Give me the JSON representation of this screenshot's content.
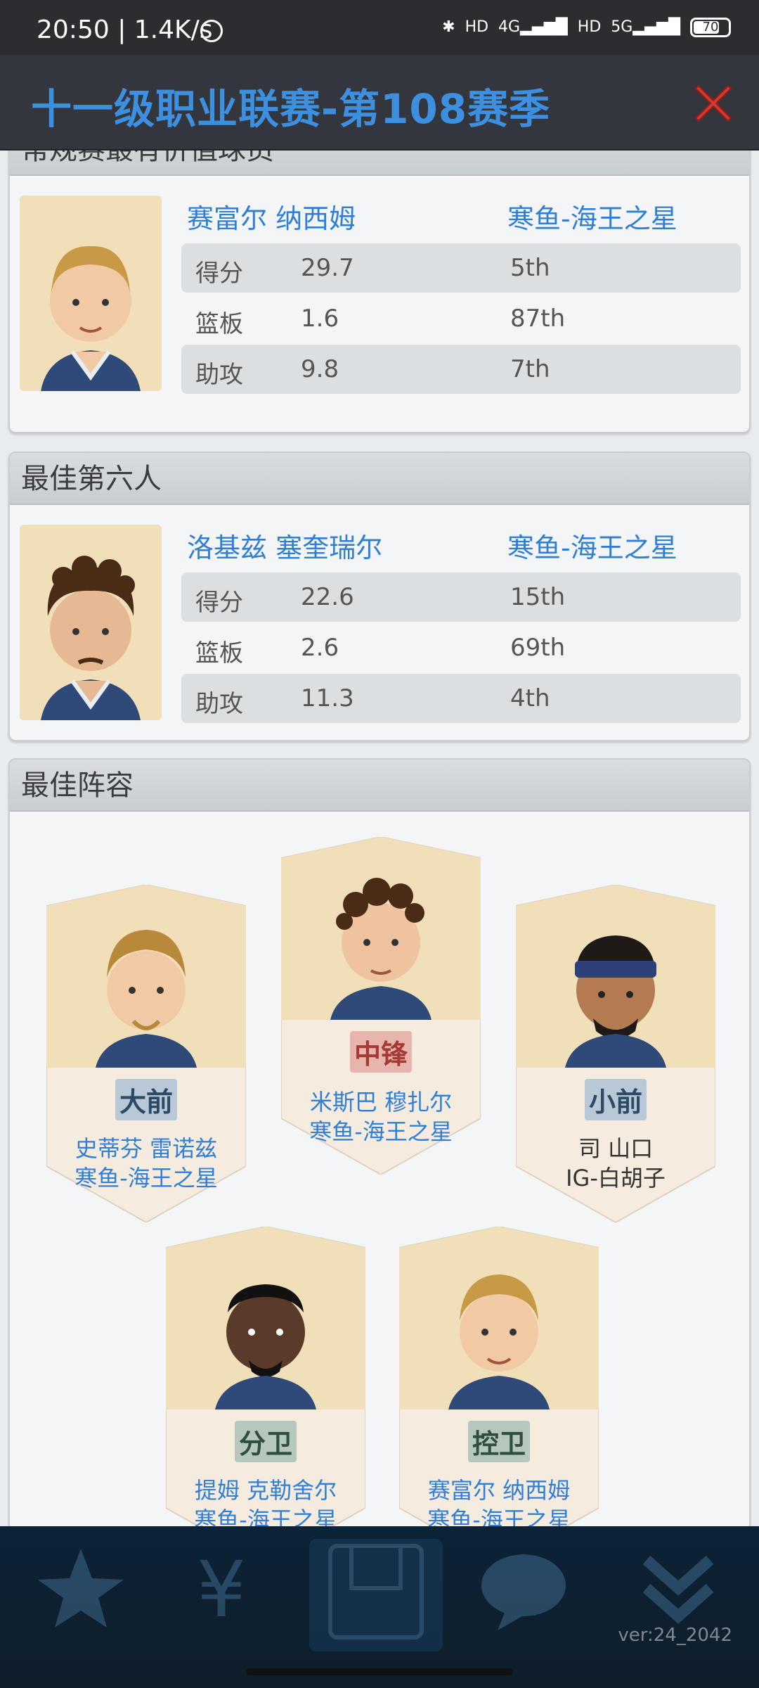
{
  "status_bar": {
    "time": "20:50",
    "speed": "1.4K/s",
    "battery": "70",
    "net1": "4G",
    "net2": "5G",
    "hd": "HD"
  },
  "header": {
    "title": "十一级职业联赛-第108赛季"
  },
  "mvp": {
    "heading": "常规赛最有价值球员",
    "player": "赛富尔 纳西姆",
    "team": "寒鱼-海王之星",
    "stats": [
      {
        "label": "得分",
        "value": "29.7",
        "rank": "5th"
      },
      {
        "label": "篮板",
        "value": "1.6",
        "rank": "87th"
      },
      {
        "label": "助攻",
        "value": "9.8",
        "rank": "7th"
      }
    ]
  },
  "sixth_man": {
    "heading": "最佳第六人",
    "player": "洛基兹 塞奎瑞尔",
    "team": "寒鱼-海王之星",
    "stats": [
      {
        "label": "得分",
        "value": "22.6",
        "rank": "15th"
      },
      {
        "label": "篮板",
        "value": "2.6",
        "rank": "69th"
      },
      {
        "label": "助攻",
        "value": "11.3",
        "rank": "4th"
      }
    ]
  },
  "lineup": {
    "heading": "最佳阵容",
    "players": [
      {
        "position": "大前",
        "name": "史蒂芬 雷诺兹",
        "team": "寒鱼-海王之星"
      },
      {
        "position": "中锋",
        "name": "米斯巴 穆扎尔",
        "team": "寒鱼-海王之星"
      },
      {
        "position": "小前",
        "name": "司 山口",
        "team": "IG-白胡子"
      },
      {
        "position": "分卫",
        "name": "提姆 克勒舍尔",
        "team": "寒鱼-海王之星"
      },
      {
        "position": "控卫",
        "name": "赛富尔 纳西姆",
        "team": "寒鱼-海王之星"
      }
    ]
  },
  "footer": {
    "version": "ver:24_2042"
  }
}
